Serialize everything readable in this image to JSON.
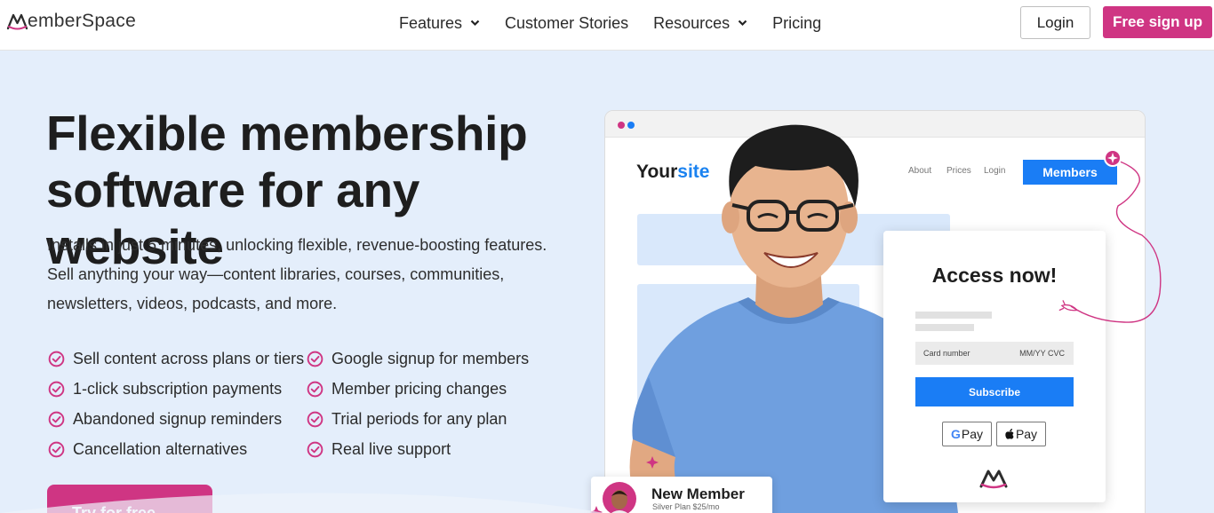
{
  "brand": {
    "logo_text": "emberSpace",
    "accent": "#cf3583",
    "blue": "#1a7df5"
  },
  "nav": {
    "links": [
      {
        "label": "Features",
        "dropdown": true
      },
      {
        "label": "Customer Stories",
        "dropdown": false
      },
      {
        "label": "Resources",
        "dropdown": true
      },
      {
        "label": "Pricing",
        "dropdown": false
      }
    ],
    "login": "Login",
    "signup": "Free sign up"
  },
  "hero": {
    "title": "Flexible membership software for any website",
    "subtitle": "Installs in just 5 minutes, unlocking flexible, revenue-boosting features. Sell anything your way—content libraries, courses, communities, newsletters, videos, podcasts, and more.",
    "features": [
      "Sell content across plans or tiers",
      "Google signup for members",
      "1-click subscription payments",
      "Member pricing changes",
      "Abandoned signup reminders",
      "Trial periods for any plan",
      "Cancellation alternatives",
      "Real live support"
    ],
    "cta": "Try for free →"
  },
  "mock": {
    "brand_a": "Your",
    "brand_b": "site",
    "nav": [
      "About",
      "Prices",
      "Login"
    ],
    "members_button": "Members",
    "card_title": "Access now!",
    "card_number": "Card number",
    "card_exp": "MM/YY CVC",
    "subscribe": "Subscribe",
    "gpay": "Pay",
    "applepay": "Pay",
    "new_member_title": "New Member",
    "new_member_sub": "Silver Plan $25/mo"
  }
}
